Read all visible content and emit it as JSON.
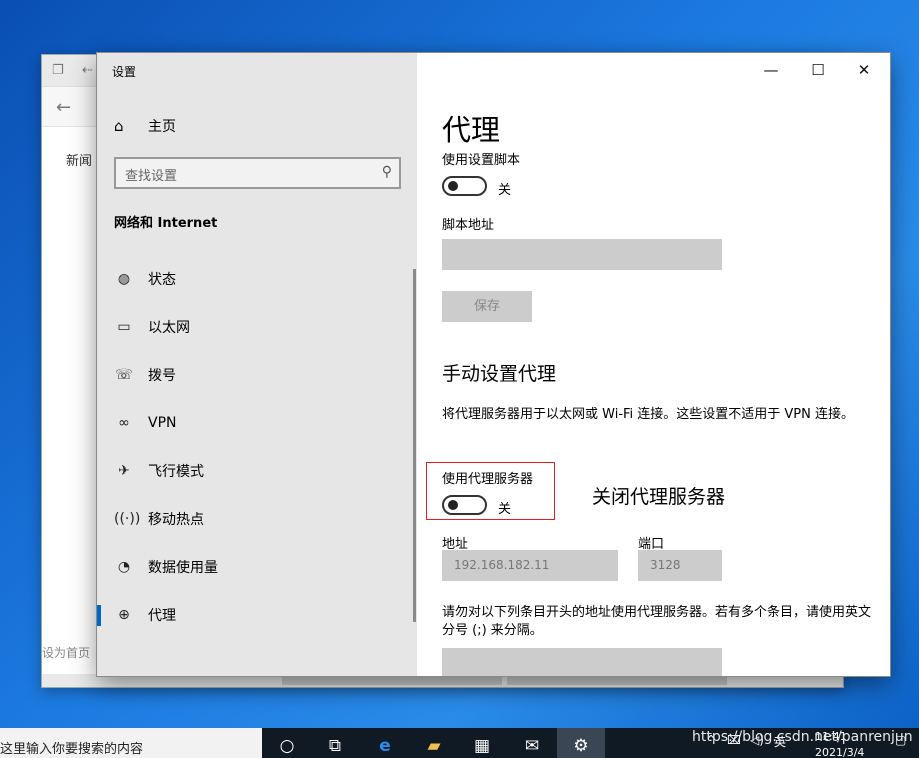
{
  "background_window": {
    "news_label": "新闻",
    "homepage_label": "设为首页"
  },
  "settings": {
    "window_title": "设置",
    "sidebar": {
      "home_label": "主页",
      "search_placeholder": "查找设置",
      "section_title": "网络和 Internet",
      "items": [
        {
          "label": "状态",
          "icon": "globe-icon"
        },
        {
          "label": "以太网",
          "icon": "ethernet-icon"
        },
        {
          "label": "拨号",
          "icon": "dialup-icon"
        },
        {
          "label": "VPN",
          "icon": "vpn-icon"
        },
        {
          "label": "飞行模式",
          "icon": "airplane-icon"
        },
        {
          "label": "移动热点",
          "icon": "hotspot-icon"
        },
        {
          "label": "数据使用量",
          "icon": "data-usage-icon"
        },
        {
          "label": "代理",
          "icon": "proxy-globe-icon",
          "selected": true
        }
      ]
    },
    "main": {
      "page_title": "代理",
      "setup_script_label": "使用设置脚本",
      "setup_script_state": "关",
      "script_address_label": "脚本地址",
      "script_address_value": "",
      "save_label": "保存",
      "manual_title": "手动设置代理",
      "manual_desc": "将代理服务器用于以太网或 Wi-Fi 连接。这些设置不适用于 VPN 连接。",
      "use_proxy_label": "使用代理服务器",
      "use_proxy_state": "关",
      "annotation": "关闭代理服务器",
      "address_label": "地址",
      "address_value": "192.168.182.11",
      "port_label": "端口",
      "port_value": "3128",
      "exceptions_desc": "请勿对以下列条目开头的地址使用代理服务器。若有多个条目，请使用英文分号 (;) 来分隔。"
    }
  },
  "taskbar": {
    "search_text": "这里输入你要搜索的内容",
    "ime_label": "英",
    "time": "11:41",
    "date": "2021/3/4",
    "watermark": "https://blog.csdn.net/panrenjun"
  },
  "colors": {
    "accent": "#0067c0",
    "highlight_box": "#e02020",
    "sidebar_bg": "#e6e6e6",
    "disabled_fill": "#cccccc"
  }
}
